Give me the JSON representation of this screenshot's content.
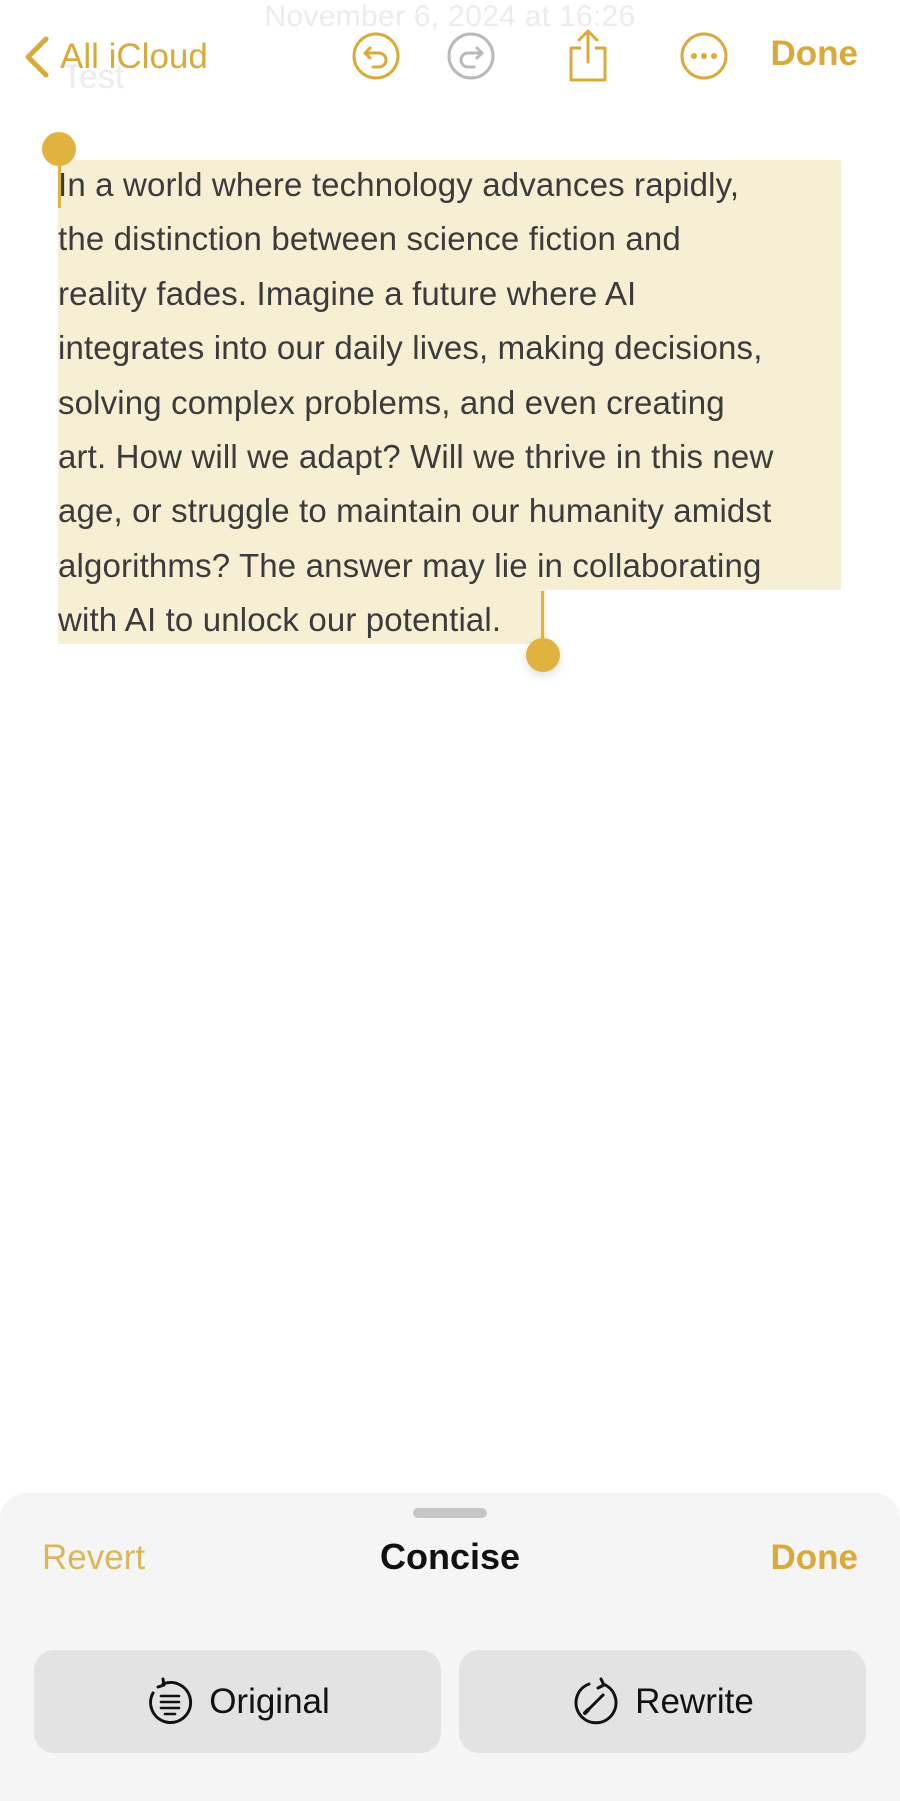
{
  "header": {
    "ghost_date": "November 6, 2024 at 16:26",
    "ghost_title": "Test",
    "back_label": "All iCloud",
    "done_label": "Done",
    "icons": [
      "chevron-left-icon",
      "undo-icon",
      "redo-icon",
      "share-icon",
      "more-icon"
    ]
  },
  "note": {
    "lines": [
      "In a world where technology advances rapidly,",
      "the distinction between science fiction and",
      "reality fades. Imagine a future where AI",
      "integrates into our daily lives, making decisions,",
      "solving complex problems, and even creating",
      "art. How will we adapt? Will we thrive in this new",
      "age, or struggle to maintain our humanity amidst",
      "algorithms? The answer may lie in collaborating",
      "with AI to unlock our potential."
    ]
  },
  "writing_tools": {
    "revert_label": "Revert",
    "title": "Concise",
    "done_label": "Done",
    "original_label": "Original",
    "rewrite_label": "Rewrite",
    "original_icon": "original-text-icon",
    "rewrite_icon": "rewrite-icon"
  },
  "colors": {
    "accent": "#d9a93a",
    "selection": "#f6efd4",
    "sheet_background": "#f5f5f5",
    "button_background": "#e3e3e3"
  }
}
